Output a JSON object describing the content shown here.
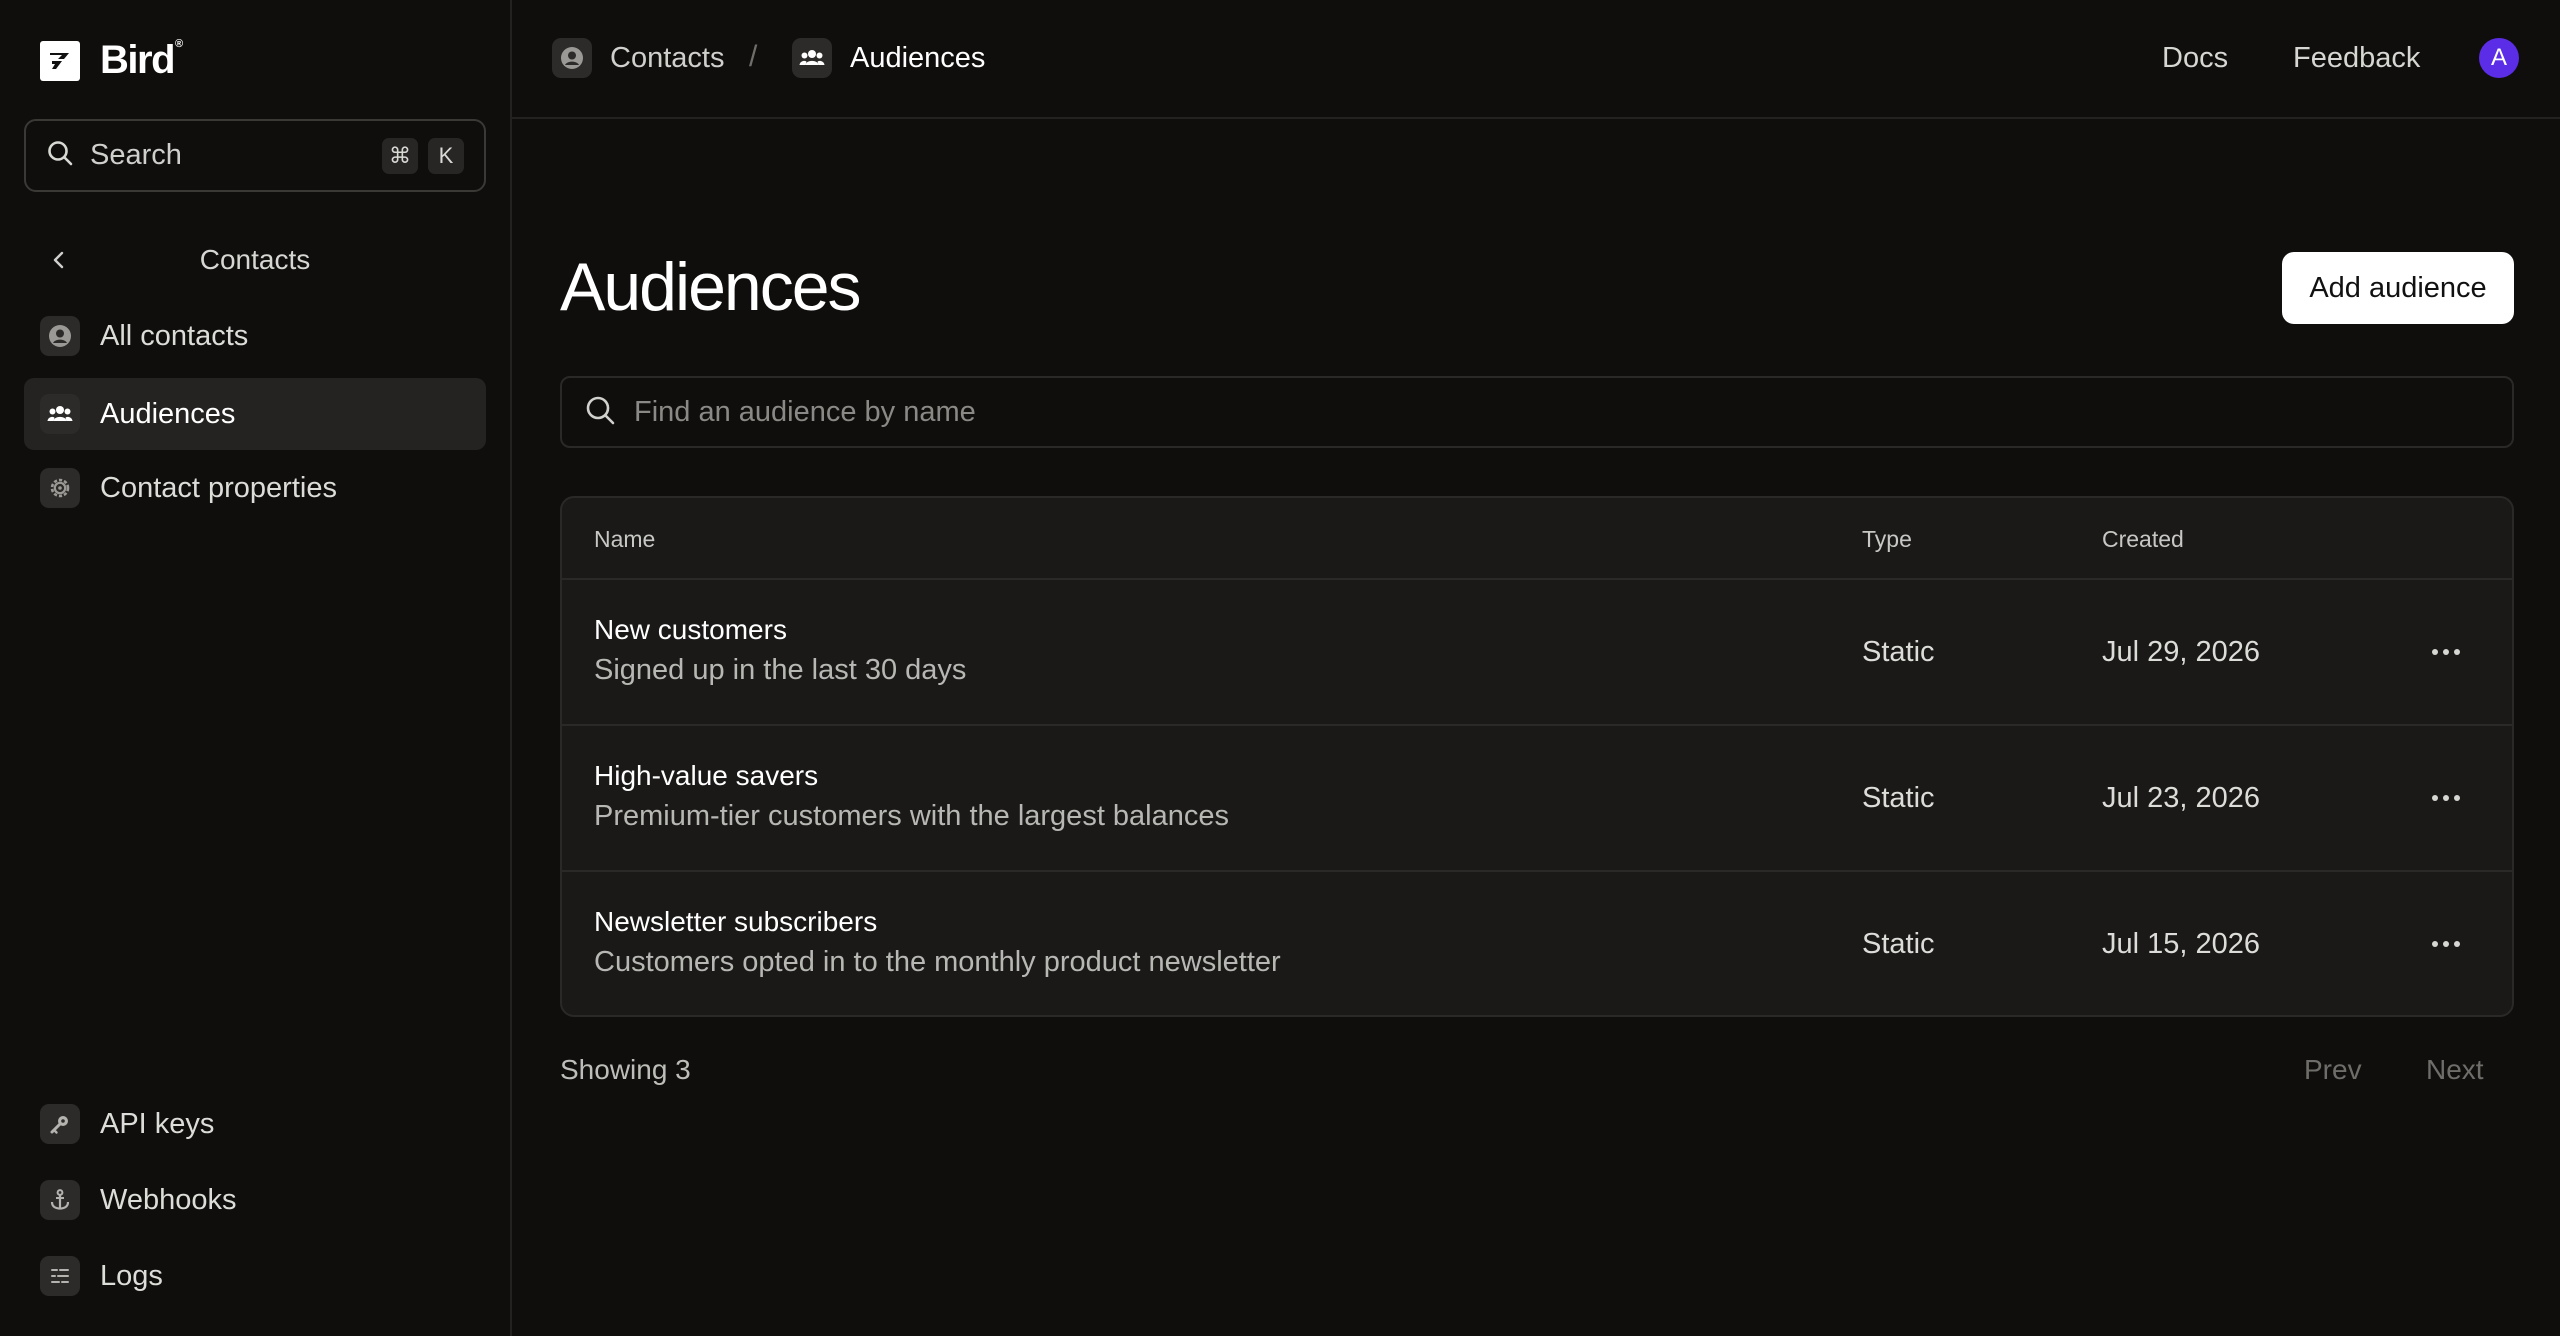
{
  "brand": {
    "name": "Bird",
    "reg": "®"
  },
  "search": {
    "label": "Search",
    "keys": [
      "⌘",
      "K"
    ]
  },
  "sidebar": {
    "section_title": "Contacts",
    "items": [
      {
        "label": "All contacts",
        "icon": "user-circle-icon",
        "active": false
      },
      {
        "label": "Audiences",
        "icon": "users-group-icon",
        "active": true
      },
      {
        "label": "Contact properties",
        "icon": "gear-icon",
        "active": false
      }
    ],
    "bottom_items": [
      {
        "label": "API keys",
        "icon": "key-icon"
      },
      {
        "label": "Webhooks",
        "icon": "anchor-icon"
      },
      {
        "label": "Logs",
        "icon": "logs-icon"
      }
    ]
  },
  "topbar": {
    "breadcrumb": [
      {
        "label": "Contacts",
        "icon": "user-circle-icon"
      },
      {
        "label": "Audiences",
        "icon": "users-group-icon"
      }
    ],
    "separator": "/",
    "links": [
      "Docs",
      "Feedback"
    ],
    "avatar_initial": "A"
  },
  "main": {
    "title": "Audiences",
    "add_button": "Add audience",
    "find_placeholder": "Find an audience by name",
    "columns": [
      "Name",
      "Type",
      "Created"
    ],
    "rows": [
      {
        "name": "New customers",
        "description": "Signed up in the last 30 days",
        "type": "Static",
        "created": "Jul 29, 2026"
      },
      {
        "name": "High-value savers",
        "description": "Premium-tier customers with the largest balances",
        "type": "Static",
        "created": "Jul 23, 2026"
      },
      {
        "name": "Newsletter subscribers",
        "description": "Customers opted in to the monthly product newsletter",
        "type": "Static",
        "created": "Jul 15, 2026"
      }
    ],
    "footer": {
      "showing": "Showing 3",
      "prev": "Prev",
      "next": "Next"
    }
  },
  "colors": {
    "background": "#0f0e0d",
    "panel": "#1a1918",
    "accent_avatar": "#5b2de6",
    "button_bg": "#ffffff"
  }
}
